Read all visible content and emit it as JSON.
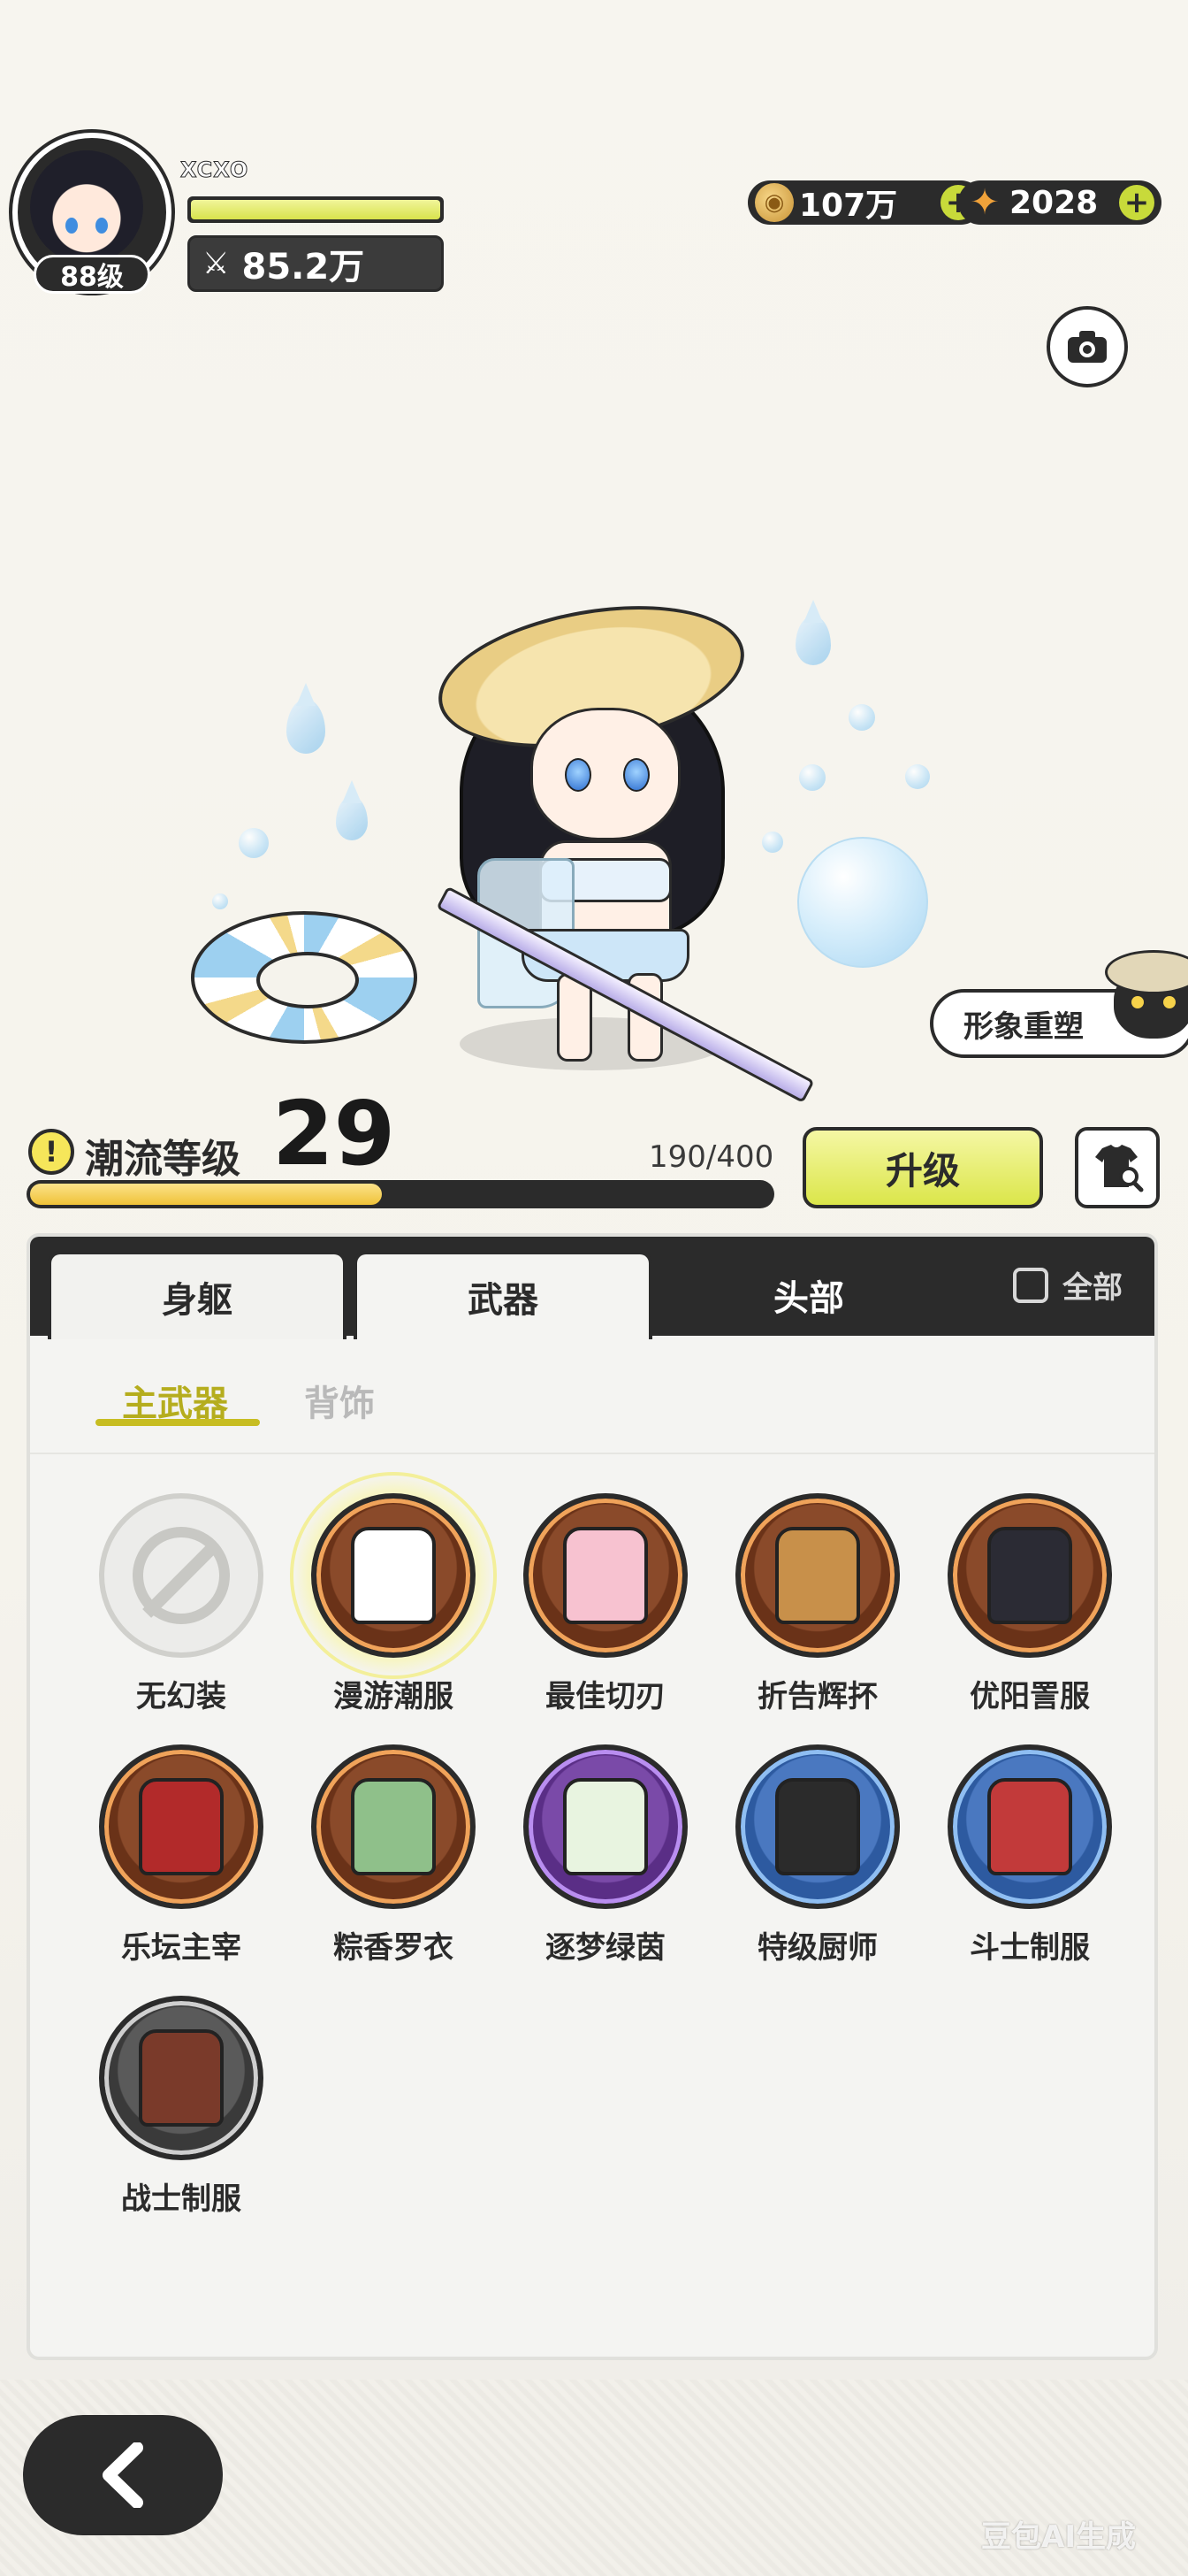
{
  "player": {
    "name": "XCXO",
    "level_label": "88级",
    "power": "85.2万"
  },
  "currencies": [
    {
      "name": "coin",
      "icon": "coin-icon",
      "value": "107万"
    },
    {
      "name": "star",
      "icon": "star-shard-icon",
      "value": "2028"
    }
  ],
  "actions": {
    "reshape": "形象重塑",
    "upgrade": "升级"
  },
  "trend": {
    "label": "潮流等级",
    "level": "29",
    "progress_text": "190/400",
    "progress_fraction": 0.475
  },
  "tabs": [
    {
      "label": "身躯",
      "state": "inactive"
    },
    {
      "label": "武器",
      "state": "active"
    },
    {
      "label": "头部",
      "state": "inactive"
    }
  ],
  "all_toggle": {
    "label": "全部",
    "checked": false
  },
  "subtabs": [
    {
      "label": "主武器",
      "active": true
    },
    {
      "label": "背饰",
      "active": false
    }
  ],
  "items": [
    {
      "label": "无幻装",
      "rarity": "none",
      "selected": false
    },
    {
      "label": "漫游潮服",
      "rarity": "orange",
      "selected": true
    },
    {
      "label": "最佳切刃",
      "rarity": "orange",
      "selected": false
    },
    {
      "label": "折告辉抔",
      "rarity": "orange",
      "selected": false
    },
    {
      "label": "优阳詈服",
      "rarity": "orange",
      "selected": false
    },
    {
      "label": "乐坛主宰",
      "rarity": "orange",
      "selected": false
    },
    {
      "label": "粽香罗衣",
      "rarity": "orange",
      "selected": false
    },
    {
      "label": "逐梦绿茵",
      "rarity": "purple",
      "selected": false
    },
    {
      "label": "特级厨师",
      "rarity": "blue",
      "selected": false
    },
    {
      "label": "斗士制服",
      "rarity": "blue",
      "selected": false
    },
    {
      "label": "战士制服",
      "rarity": "gray",
      "selected": false
    }
  ],
  "watermark": "豆包AI生成",
  "colors": {
    "accent_yellow": "#dbe64a",
    "dark": "#2b2b2b",
    "subtab_active": "#b5ad1e"
  }
}
